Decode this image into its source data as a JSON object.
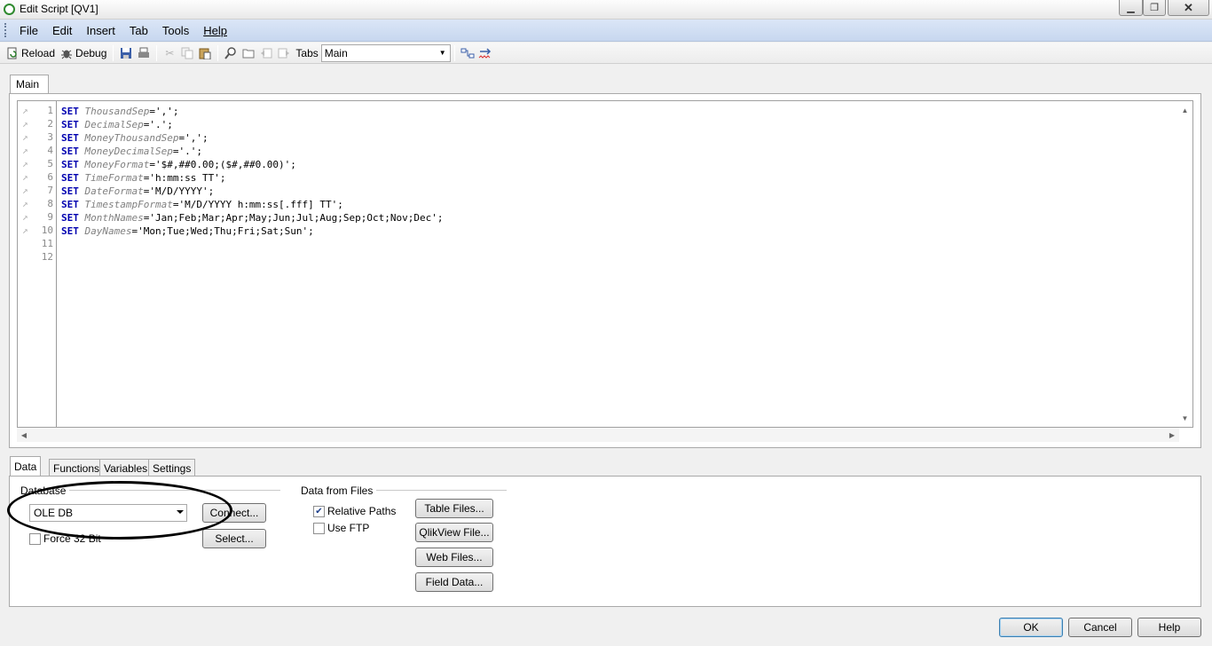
{
  "window": {
    "title": "Edit Script [QV1]",
    "min_label": "▁",
    "max_label": "❐",
    "close_label": "✕"
  },
  "menu": [
    "File",
    "Edit",
    "Insert",
    "Tab",
    "Tools",
    "Help"
  ],
  "toolbar": {
    "reload_label": "Reload",
    "debug_label": "Debug",
    "tabs_label": "Tabs",
    "tabs_selected": "Main"
  },
  "script_tab": "Main",
  "script": {
    "line_numbers": [
      "1",
      "2",
      "3",
      "4",
      "5",
      "6",
      "7",
      "8",
      "9",
      "10",
      "11",
      "12"
    ],
    "lines": [
      {
        "kw": "SET",
        "var": "ThousandSep",
        "val": "=',';"
      },
      {
        "kw": "SET",
        "var": "DecimalSep",
        "val": "='.';"
      },
      {
        "kw": "SET",
        "var": "MoneyThousandSep",
        "val": "=',';"
      },
      {
        "kw": "SET",
        "var": "MoneyDecimalSep",
        "val": "='.';"
      },
      {
        "kw": "SET",
        "var": "MoneyFormat",
        "val": "='$#,##0.00;($#,##0.00)';"
      },
      {
        "kw": "SET",
        "var": "TimeFormat",
        "val": "='h:mm:ss TT';"
      },
      {
        "kw": "SET",
        "var": "DateFormat",
        "val": "='M/D/YYYY';"
      },
      {
        "kw": "SET",
        "var": "TimestampFormat",
        "val": "='M/D/YYYY h:mm:ss[.fff] TT';"
      },
      {
        "kw": "SET",
        "var": "MonthNames",
        "val": "='Jan;Feb;Mar;Apr;May;Jun;Jul;Aug;Sep;Oct;Nov;Dec';"
      },
      {
        "kw": "SET",
        "var": "DayNames",
        "val": "='Mon;Tue;Wed;Thu;Fri;Sat;Sun';"
      }
    ]
  },
  "bottom_tabs": [
    "Data",
    "Functions",
    "Variables",
    "Settings"
  ],
  "database": {
    "group_label": "Database",
    "selected": "OLE DB",
    "connect_label": "Connect...",
    "select_label": "Select...",
    "force32_label": "Force 32 Bit",
    "force32_checked": false
  },
  "files": {
    "group_label": "Data from Files",
    "relative_paths_label": "Relative Paths",
    "relative_paths_checked": true,
    "use_ftp_label": "Use FTP",
    "use_ftp_checked": false,
    "table_files_label": "Table Files...",
    "qlikview_file_label": "QlikView File...",
    "web_files_label": "Web Files...",
    "field_data_label": "Field Data..."
  },
  "dialog_buttons": {
    "ok": "OK",
    "cancel": "Cancel",
    "help": "Help"
  }
}
